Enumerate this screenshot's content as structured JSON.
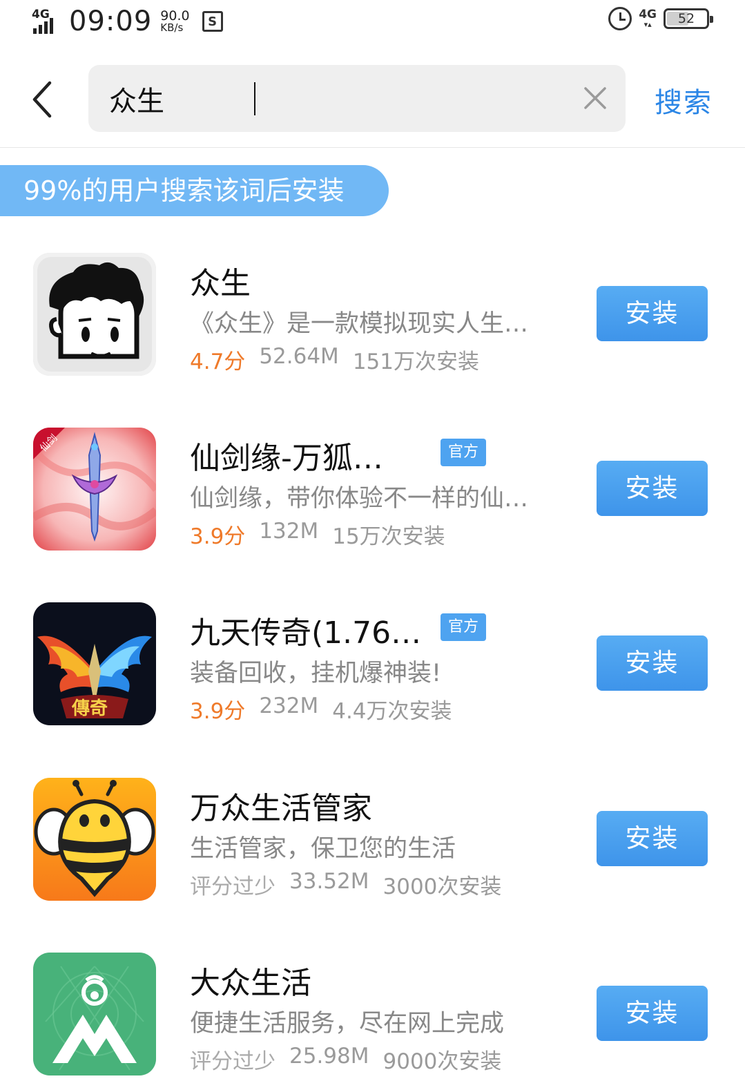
{
  "status_bar": {
    "network": "4G",
    "time": "09:09",
    "speed_value": "90.0",
    "speed_unit": "KB/s",
    "s_icon": "S",
    "right_network": "4G",
    "battery_level": "52",
    "battery_fraction": 0.52,
    "icons": [
      "signal-icon",
      "s-app-icon",
      "alarm-icon",
      "battery-icon"
    ]
  },
  "search": {
    "query": "众生",
    "button_label": "搜索",
    "icons": [
      "back-arrow-icon",
      "clear-icon"
    ]
  },
  "banner": {
    "text": "99%的用户搜索该词后安装"
  },
  "colors": {
    "accent": "#2b86e6",
    "banner": "#71b8f5",
    "install_button": "#4a9ff0",
    "rating": "#ef7a2a",
    "badge": "#4ea3f0"
  },
  "apps": [
    {
      "name": "众生",
      "badge": "",
      "description": "《众生》是一款模拟现实人生…",
      "rating": "4.7分",
      "size": "52.64M",
      "installs": "151万次安装",
      "install_label": "安装",
      "icon": "cartoon-face-icon"
    },
    {
      "name": "仙剑缘-万狐…",
      "badge": "官方",
      "description": "仙剑缘，带你体验不一样的仙…",
      "rating": "3.9分",
      "size": "132M",
      "installs": "15万次安装",
      "install_label": "安装",
      "icon": "sword-icon",
      "icon_text": "仙剑"
    },
    {
      "name": "九天传奇(1.76…",
      "badge": "官方",
      "description": "装备回收，挂机爆神装!",
      "rating": "3.9分",
      "size": "232M",
      "installs": "4.4万次安装",
      "install_label": "安装",
      "icon": "phoenix-wings-icon",
      "icon_text": "傳奇"
    },
    {
      "name": "万众生活管家",
      "badge": "",
      "description": "生活管家，保卫您的生活",
      "rating": "评分过少",
      "size": "33.52M",
      "installs": "3000次安装",
      "install_label": "安装",
      "icon": "bee-icon"
    },
    {
      "name": "大众生活",
      "badge": "",
      "description": "便捷生活服务，尽在网上完成",
      "rating": "评分过少",
      "size": "25.98M",
      "installs": "9000次安装",
      "install_label": "安装",
      "icon": "spider-m-logo-icon"
    }
  ]
}
